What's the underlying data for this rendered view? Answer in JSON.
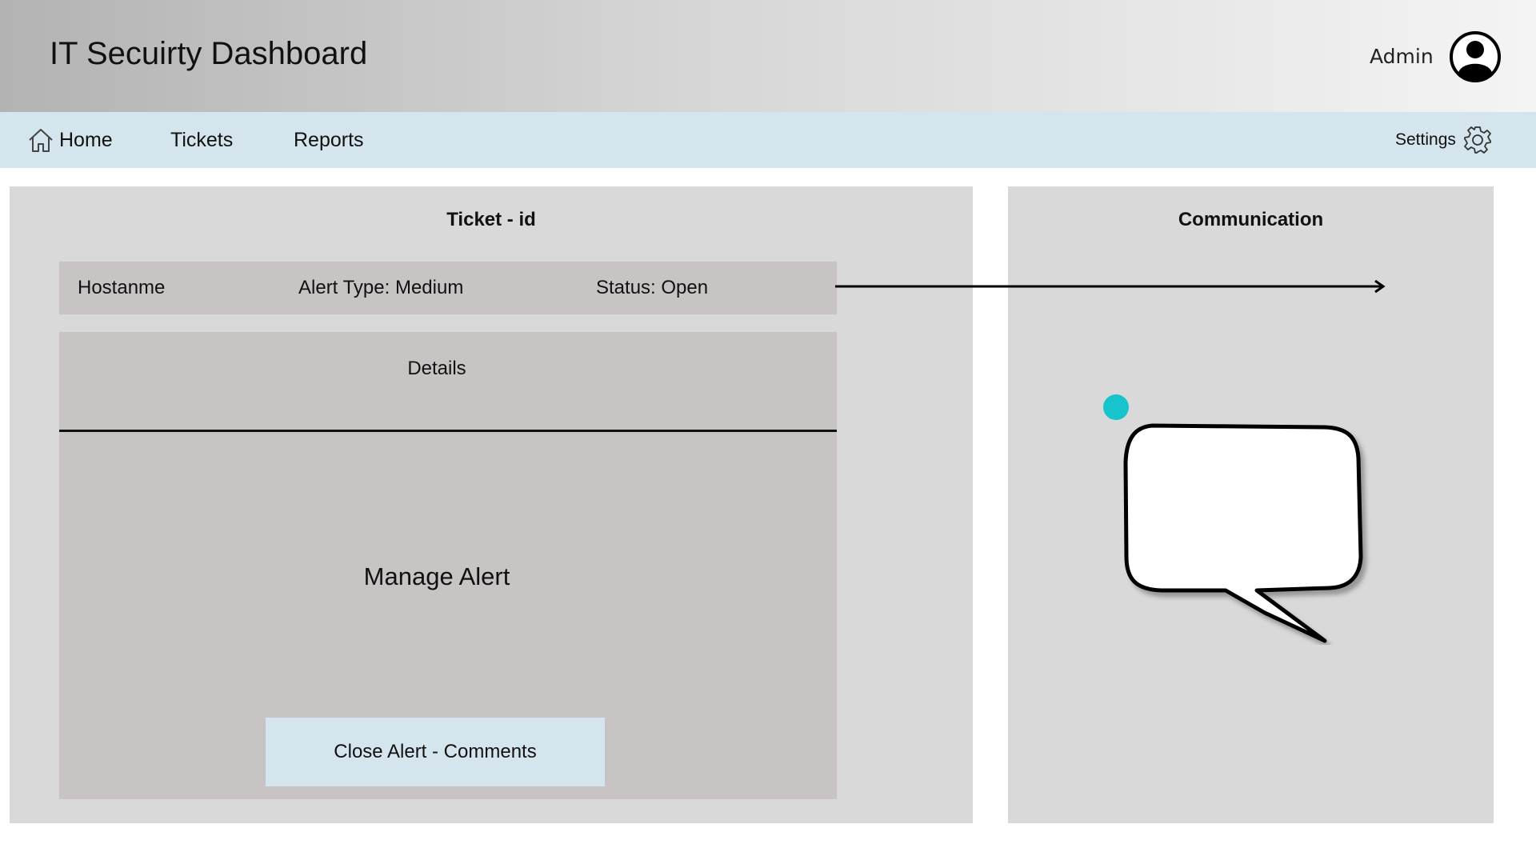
{
  "header": {
    "title": "IT Secuirty Dashboard",
    "user_label": "Admin",
    "avatar_icon": "user-circle-icon"
  },
  "nav": {
    "home_label": "Home",
    "home_icon": "home-icon",
    "tickets_label": "Tickets",
    "reports_label": "Reports",
    "settings_label": "Settings",
    "settings_icon": "gear-icon"
  },
  "ticket": {
    "title": "Ticket - id",
    "hostname": "Hostanme",
    "alert_type": "Alert Type: Medium",
    "status": "Status: Open",
    "details_label": "Details",
    "manage_label": "Manage Alert",
    "close_button_label": "Close Alert - Comments"
  },
  "communication": {
    "title": "Communication",
    "bubble_icon": "speech-bubble-icon",
    "dot_color": "#17c3cc"
  },
  "colors": {
    "nav_bg": "#d4e5ee",
    "panel_bg": "#d9d9d9",
    "box_bg": "#c8c4c4",
    "button_bg": "#d4e5ee"
  }
}
